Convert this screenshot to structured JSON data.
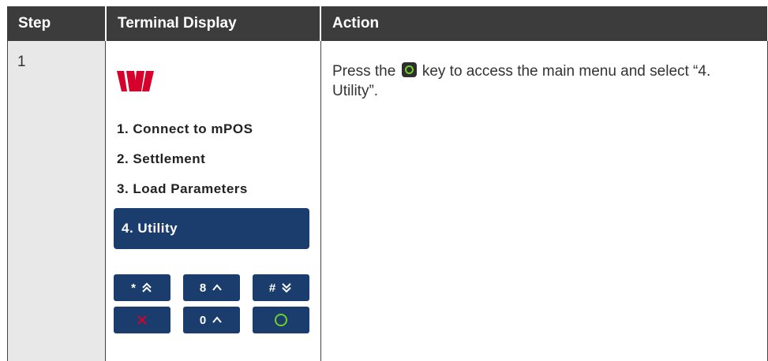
{
  "table": {
    "headers": {
      "step": "Step",
      "terminal_display": "Terminal Display",
      "action": "Action"
    },
    "rows": [
      {
        "step": "1",
        "terminal": {
          "logo": "westpac-logo",
          "menu_items": [
            "1. Connect to mPOS",
            "2. Settlement",
            "3. Load Parameters"
          ],
          "selected_item": "4. Utility",
          "keys": [
            {
              "label": "*",
              "icon": "double-chevron-up-icon"
            },
            {
              "label": "8",
              "icon": "chevron-up-icon"
            },
            {
              "label": "#",
              "icon": "double-chevron-down-icon"
            },
            {
              "label": "",
              "icon": "x-icon"
            },
            {
              "label": "0",
              "icon": "chevron-up-icon"
            },
            {
              "label": "",
              "icon": "circle-icon"
            }
          ]
        },
        "action": {
          "before_key": "Press the",
          "key_icon": "green-enter-key-icon",
          "after_key": "key to access the main menu and select “4. Utility”."
        }
      }
    ]
  },
  "colors": {
    "header_bg": "#3c3c3c",
    "step_cell_bg": "#e8e8e8",
    "key_bg": "#1b3d6e",
    "logo_red": "#d5002b",
    "accent_green": "#6fcf2a"
  }
}
